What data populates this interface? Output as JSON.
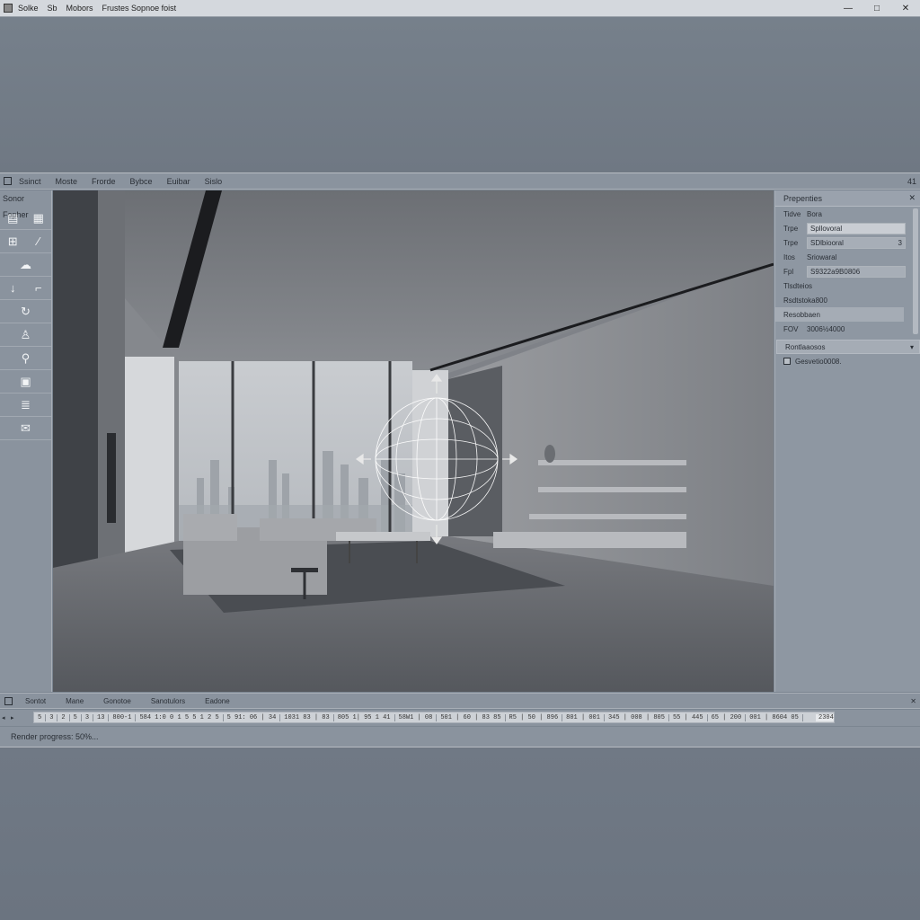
{
  "titlebar": {
    "items": [
      "Solke",
      "Sb",
      "Mobors",
      "Frustes Sopnoe foist"
    ],
    "controls": [
      "—",
      "□",
      "✕"
    ]
  },
  "menubar": {
    "items": [
      "Ssinct",
      "Moste",
      "Frorde",
      "Bybce",
      "Euibar",
      "Sislo"
    ],
    "end": "41"
  },
  "toolbox": {
    "title": "Sonor Fopher"
  },
  "properties": {
    "header": "Prepenties",
    "close": "✕",
    "rows": [
      {
        "k": "Tidve",
        "v": "Bora"
      },
      {
        "k": "Trpe",
        "v": "Spllovoral"
      },
      {
        "k": "Trpe",
        "v": "SDlbiooral",
        "extra": "3"
      },
      {
        "k": "Itos",
        "v": "Sriowaral"
      },
      {
        "k": "Fpl",
        "v": "S9322a9B0806"
      }
    ],
    "section1": "Tlsdteios",
    "section2": "Rsdtstoka800",
    "section3": "Resobbaen",
    "fov_label": "FOV",
    "fov_value": "3006½4000",
    "dropdown_label": "Rontlaaosos",
    "check_label": "Gesvetio0008."
  },
  "timeline": {
    "tabs": [
      "Sontot",
      "Mane",
      "Gonotoe",
      "Sanotulors",
      "Eadone"
    ],
    "controls": [
      "◂",
      "▸"
    ],
    "ticks": [
      "5",
      "3",
      "2",
      "5",
      "3",
      "13",
      "800-1",
      "584 1:0 0 1 5 5 1 2 5",
      "5 91: 06 | 34",
      "1031 83 | 83",
      "805 1| 95 1 41",
      "58W1 | 08",
      "501 | 60 | 83 85",
      "R5 | 50 | 896",
      "801 | 001",
      "345 | 008 | 805",
      "55 | 445",
      "65 | 200",
      "001 | 8604 05"
    ],
    "end_value": "2304"
  },
  "status": {
    "text": "Render progress: 50%..."
  },
  "icons": {
    "tools": [
      "layers-icon",
      "grid-icon",
      "transform-icon",
      "brush-icon",
      "light-icon",
      "arrow-down-icon",
      "crop-icon",
      "rotate-icon",
      "figure-icon",
      "zoom-icon",
      "image-icon",
      "layers-stack-icon",
      "mail-icon"
    ]
  }
}
